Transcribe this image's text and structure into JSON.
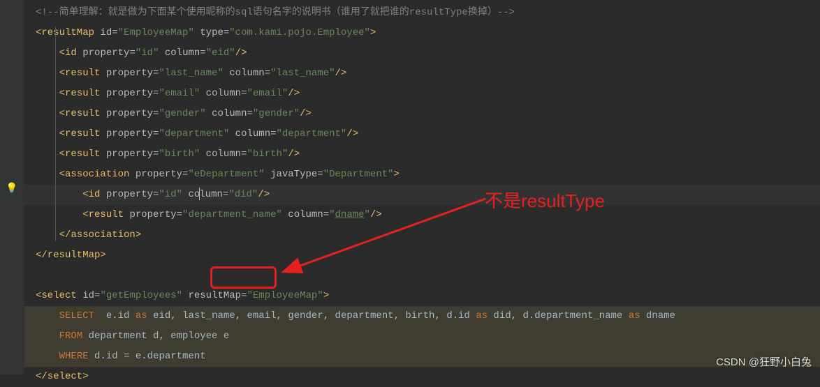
{
  "comment": "<!--简单理解：就是做为下面某个使用昵称的sql语句名字的说明书（谁用了就把谁的resultType换掉）-->",
  "resultMap": {
    "open": "<resultMap",
    "idAttr": "id",
    "idVal": "\"EmployeeMap\"",
    "typeAttr": "type",
    "typeVal": "\"com.kami.pojo.Employee\"",
    "close": "</resultMap>",
    "gt": ">"
  },
  "idTag": {
    "open": "<id",
    "propAttr": "property",
    "propVal": "\"id\"",
    "colAttr": "column",
    "colVal": "\"eid\"",
    "close": "/>"
  },
  "r1": {
    "open": "<result",
    "propAttr": "property",
    "propVal": "\"last_name\"",
    "colAttr": "column",
    "colVal": "\"last_name\"",
    "close": "/>"
  },
  "r2": {
    "open": "<result",
    "propAttr": "property",
    "propVal": "\"email\"",
    "colAttr": "column",
    "colVal": "\"email\"",
    "close": "/>"
  },
  "r3": {
    "open": "<result",
    "propAttr": "property",
    "propVal": "\"gender\"",
    "colAttr": "column",
    "colVal": "\"gender\"",
    "close": "/>"
  },
  "r4": {
    "open": "<result",
    "propAttr": "property",
    "propVal": "\"department\"",
    "colAttr": "column",
    "colVal": "\"department\"",
    "close": "/>"
  },
  "r5": {
    "open": "<result",
    "propAttr": "property",
    "propVal": "\"birth\"",
    "colAttr": "column",
    "colVal": "\"birth\"",
    "close": "/>"
  },
  "assoc": {
    "open": "<association",
    "propAttr": "property",
    "propVal": "\"eDepartment\"",
    "jtAttr": "javaType",
    "jtVal": "\"Department\"",
    "gt": ">",
    "close": "</association>"
  },
  "aid": {
    "open": "<id",
    "propAttr": "property",
    "propVal": "\"id\"",
    "colAttr1": "co",
    "colAttr2": "lumn",
    "colVal": "\"did\"",
    "close": "/>"
  },
  "ar": {
    "open": "<result",
    "propAttr": "property",
    "propVal": "\"department_name\"",
    "colAttr": "column",
    "colValQ1": "\"",
    "colValU": "dname",
    "colValQ2": "\"",
    "close": "/>"
  },
  "select": {
    "open": "<select",
    "idAttr": "id",
    "idVal": "\"getEmployees\"",
    "rmAttr": "resultMap",
    "rmVal": "\"EmployeeMap\"",
    "gt": ">",
    "close": "</select>"
  },
  "sql": {
    "select": "SELECT",
    "cols1": "  e.id ",
    "as": "as",
    "eid": " eid",
    "c": ",",
    "lastname": " last_name",
    "email": " email",
    "gender": " gender",
    "dept": " department",
    "birth": " birth",
    "did1": " d.id ",
    "did2": " did",
    "dname1": " d.department_name ",
    "dname2": " dname",
    "from": "FROM",
    "fromTbl": " department d",
    "fromTbl2": " employee e",
    "where": "WHERE",
    "whereCl": " d.id = e.department"
  },
  "annotation": "不是resultType",
  "watermark": "CSDN @狂野小白兔"
}
